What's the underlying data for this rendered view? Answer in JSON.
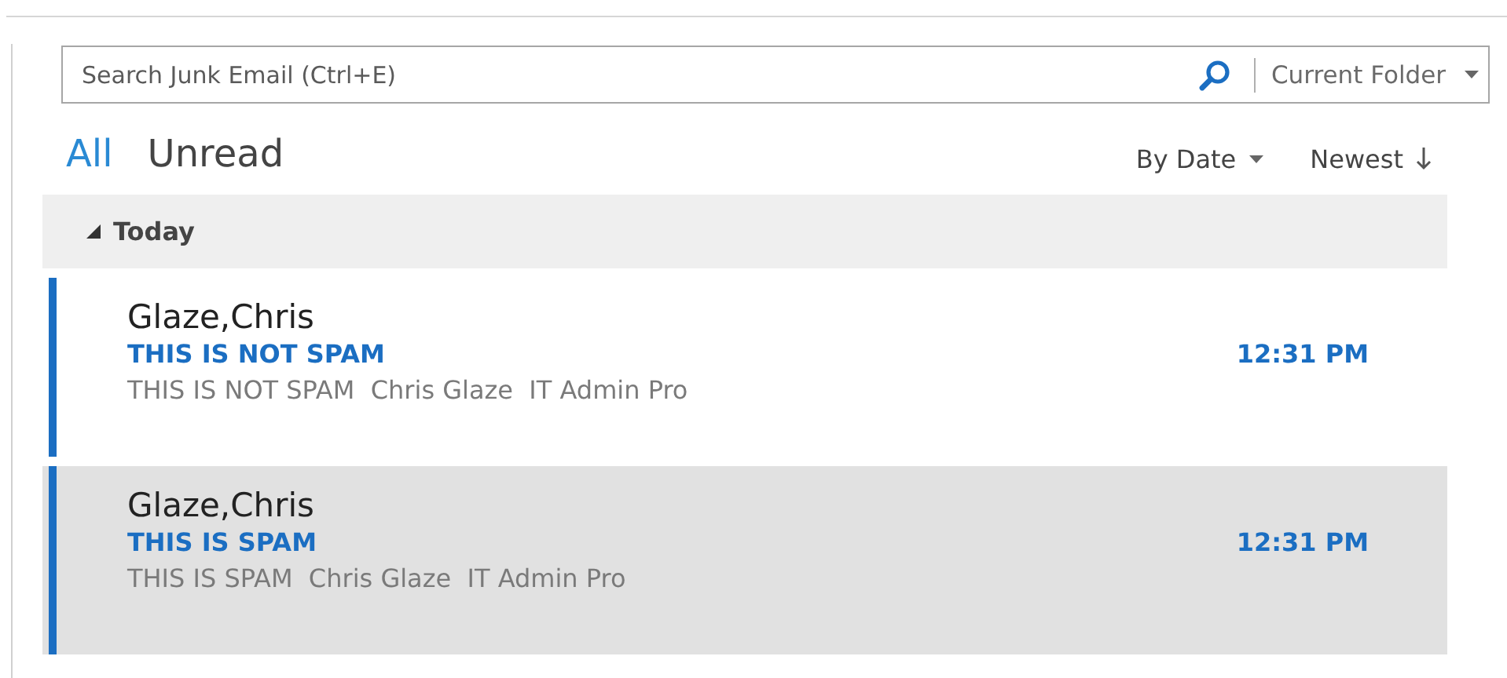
{
  "search": {
    "placeholder": "Search Junk Email (Ctrl+E)",
    "scope": "Current Folder"
  },
  "filters": [
    {
      "label": "All",
      "selected": true
    },
    {
      "label": "Unread",
      "selected": false
    }
  ],
  "sort": {
    "field": "By Date",
    "order": "Newest"
  },
  "group": {
    "label": "Today",
    "expanded": true
  },
  "messages": [
    {
      "sender": "Glaze,Chris",
      "subject": "THIS IS NOT SPAM",
      "time": "12:31 PM",
      "preview": "THIS IS NOT SPAM  Chris Glaze  IT Admin Pro",
      "unread": true,
      "selected": false
    },
    {
      "sender": "Glaze,Chris",
      "subject": "THIS IS SPAM",
      "time": "12:31 PM",
      "preview": "THIS IS SPAM  Chris Glaze  IT Admin Pro",
      "unread": true,
      "selected": true
    }
  ]
}
